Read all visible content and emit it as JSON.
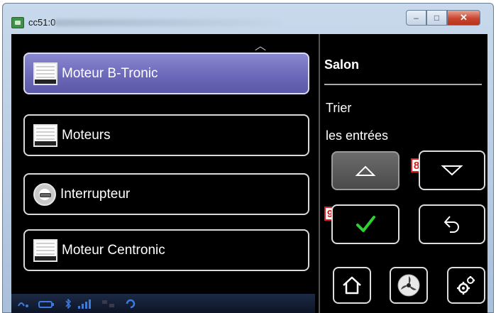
{
  "window": {
    "title": "cc51:0",
    "controls": {
      "minimize": "–",
      "maximize": "□",
      "close": "✕"
    }
  },
  "list": {
    "scroll_up_glyph": "︿",
    "entries": [
      {
        "label": "Moteur B-Tronic",
        "icon": "shutter-icon",
        "selected": true
      },
      {
        "label": "Moteurs",
        "icon": "shutter-icon",
        "selected": false
      },
      {
        "label": "Interrupteur",
        "icon": "switch-icon",
        "selected": false
      },
      {
        "label": "Moteur Centronic",
        "icon": "shutter-icon",
        "selected": false
      }
    ]
  },
  "status_bar": {
    "icons": [
      "signal-icon",
      "battery-icon",
      "bluetooth-icon",
      "signal-bars-icon",
      "network-icon",
      "sync-icon"
    ],
    "color": "#3b7be0"
  },
  "side_panel": {
    "room_name": "Salon",
    "sort_line1": "Trier",
    "sort_line2": "les entrées",
    "move_up": {
      "icon": "triangle-up-icon",
      "glyph": "△"
    },
    "move_down": {
      "icon": "triangle-down-icon",
      "glyph": "▽"
    },
    "confirm": {
      "icon": "checkmark-icon",
      "glyph": "✓",
      "color": "#2fd12f"
    },
    "back": {
      "icon": "back-arrow-icon"
    },
    "home": {
      "icon": "home-icon"
    },
    "fan": {
      "icon": "fan-icon"
    },
    "settings": {
      "icon": "settings-gears-icon"
    }
  },
  "annotations": {
    "label_8": "8",
    "label_9": "9"
  },
  "colors": {
    "selected_entry": "#6c69ba",
    "badge_border": "#e02020"
  }
}
